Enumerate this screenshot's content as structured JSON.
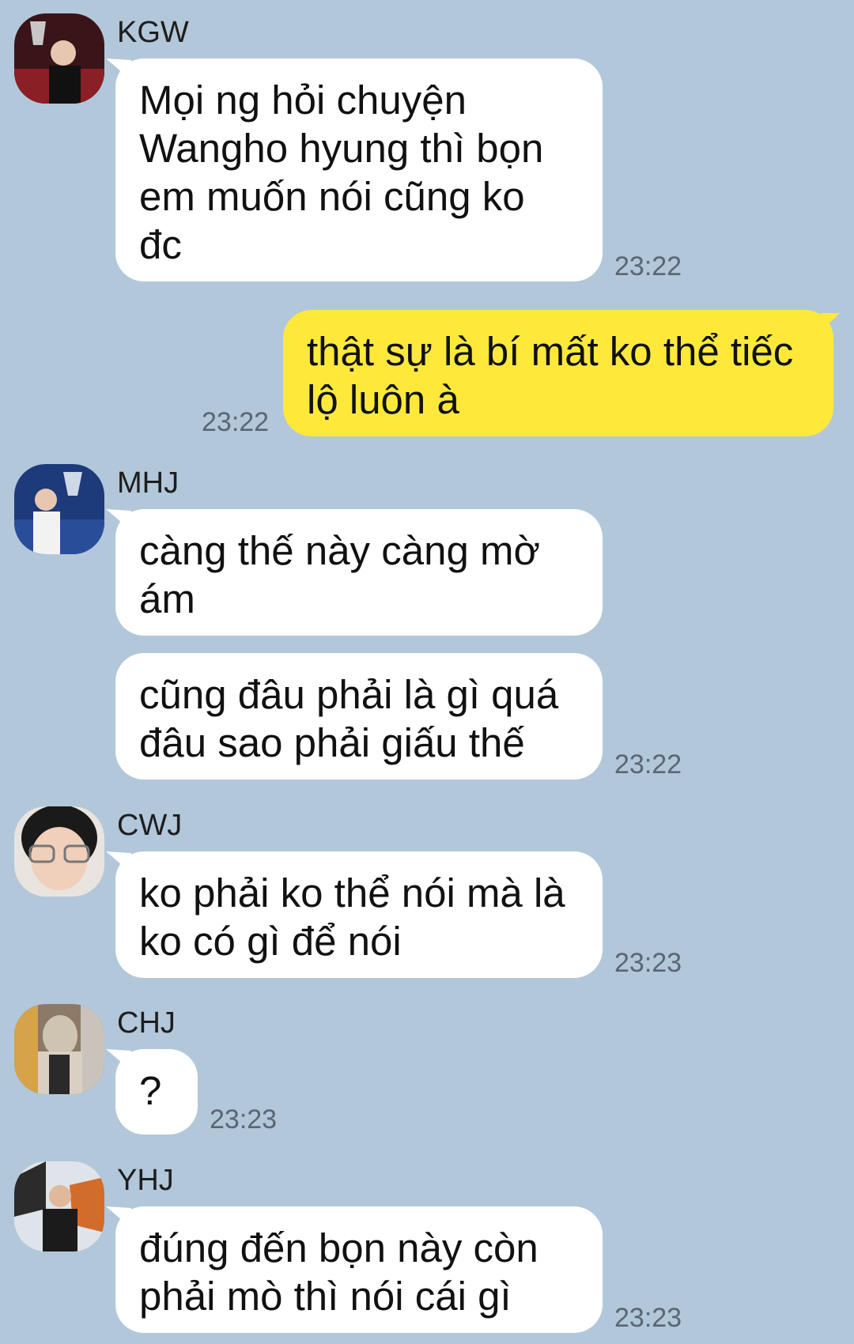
{
  "messages": [
    {
      "sender": "KGW",
      "text": "Mọi ng hỏi chuyện\nWangho hyung thì bọn\nem muốn nói cũng ko\nđc",
      "time": "23:22"
    },
    {
      "sender": "me",
      "text": "thật sự là bí mất ko thể tiếc\nlộ luôn à",
      "time": "23:22"
    },
    {
      "sender": "MHJ",
      "text": "càng thế này càng mờ\nám"
    },
    {
      "sender": "MHJ",
      "text": "cũng đâu phải là gì quá\nđâu sao phải giấu thế",
      "time": "23:22"
    },
    {
      "sender": "CWJ",
      "text": "ko phải ko thể nói mà là\nko có gì để nói",
      "time": "23:23"
    },
    {
      "sender": "CHJ",
      "text": "?",
      "time": "23:23"
    },
    {
      "sender": "YHJ",
      "text": "đúng đến bọn này còn\nphải mò thì nói cái gì",
      "time": "23:23"
    }
  ],
  "colors": {
    "background": "#b2c7da",
    "incoming_bubble": "#ffffff",
    "outgoing_bubble": "#fee93b",
    "time_text": "#5a6673"
  },
  "icons": [
    "avatar-kgw",
    "avatar-mhj",
    "avatar-cwj",
    "avatar-chj",
    "avatar-yhj"
  ]
}
